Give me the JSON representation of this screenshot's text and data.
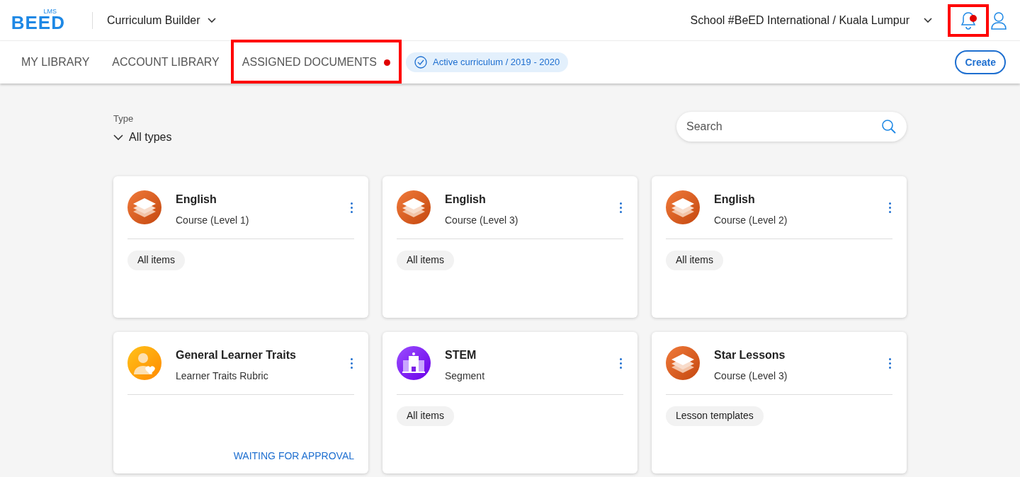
{
  "logo": {
    "badge": "LMS",
    "wordmark": "BEED"
  },
  "app_switcher": {
    "label": "Curriculum Builder"
  },
  "school_switcher": {
    "label": "School #BeED International / Kuala Lumpur"
  },
  "notifications": {
    "unread": true,
    "highlighted": true
  },
  "tabs": [
    {
      "label": "MY LIBRARY",
      "dot": false,
      "highlighted": false
    },
    {
      "label": "ACCOUNT LIBRARY",
      "dot": false,
      "highlighted": false
    },
    {
      "label": "ASSIGNED DOCUMENTS",
      "dot": true,
      "highlighted": true
    }
  ],
  "curriculum_chip": {
    "label": "Active curriculum / 2019 - 2020"
  },
  "create_button": {
    "label": "Create"
  },
  "filter": {
    "label": "Type",
    "value": "All types"
  },
  "search": {
    "placeholder": "Search"
  },
  "cards": [
    {
      "kind": "course",
      "title": "English",
      "subtitle": "Course (Level 1)",
      "tag": "All items"
    },
    {
      "kind": "course",
      "title": "English",
      "subtitle": "Course (Level 3)",
      "tag": "All items"
    },
    {
      "kind": "course",
      "title": "English",
      "subtitle": "Course (Level 2)",
      "tag": "All items"
    },
    {
      "kind": "traits",
      "title": "General Learner Traits",
      "subtitle": "Learner Traits Rubric",
      "status": "WAITING FOR APPROVAL"
    },
    {
      "kind": "segment",
      "title": "STEM",
      "subtitle": "Segment",
      "tag": "All items"
    },
    {
      "kind": "course",
      "title": "Star Lessons",
      "subtitle": "Course (Level 3)",
      "tag": "Lesson templates"
    }
  ]
}
